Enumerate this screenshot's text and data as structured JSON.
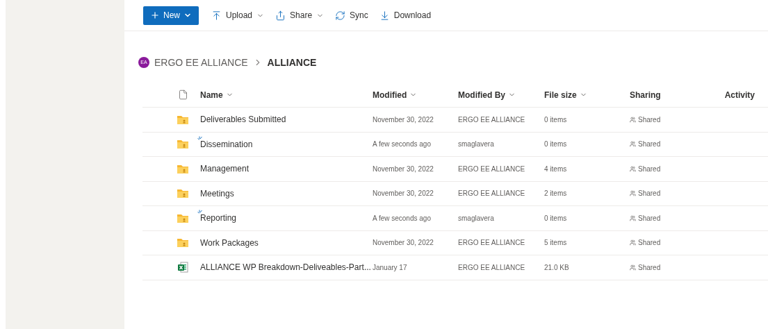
{
  "toolbar": [
    {
      "kind": "new",
      "label": "New"
    },
    {
      "kind": "upload",
      "label": "Upload",
      "menu": true
    },
    {
      "kind": "share",
      "label": "Share",
      "menu": true
    },
    {
      "kind": "sync",
      "label": "Sync",
      "menu": false
    },
    {
      "kind": "download",
      "label": "Download",
      "menu": false
    }
  ],
  "breadcrumb": {
    "avatar": "EA",
    "items": [
      "ERGO EE ALLIANCE",
      "ALLIANCE"
    ]
  },
  "table": {
    "columns": [
      {
        "label": "Name",
        "sortable": true
      },
      {
        "label": "Modified",
        "sortable": true
      },
      {
        "label": "Modified By",
        "sortable": true
      },
      {
        "label": "File size",
        "sortable": true
      },
      {
        "label": "Sharing",
        "sortable": false
      },
      {
        "label": "Activity",
        "sortable": false
      }
    ],
    "rows": [
      {
        "kind": "folder",
        "new": false,
        "name": "Deliverables Submitted",
        "modified": "November 30, 2022",
        "modified_by": "ERGO EE ALLIANCE",
        "size": "0 items",
        "sharing": "Shared"
      },
      {
        "kind": "folder",
        "new": true,
        "name": "Dissemination",
        "modified": "A few seconds ago",
        "modified_by": "smaglavera",
        "size": "0 items",
        "sharing": "Shared"
      },
      {
        "kind": "folder",
        "new": false,
        "name": "Management",
        "modified": "November 30, 2022",
        "modified_by": "ERGO EE ALLIANCE",
        "size": "4 items",
        "sharing": "Shared"
      },
      {
        "kind": "folder",
        "new": false,
        "name": "Meetings",
        "modified": "November 30, 2022",
        "modified_by": "ERGO EE ALLIANCE",
        "size": "2 items",
        "sharing": "Shared"
      },
      {
        "kind": "folder",
        "new": true,
        "name": "Reporting",
        "modified": "A few seconds ago",
        "modified_by": "smaglavera",
        "size": "0 items",
        "sharing": "Shared"
      },
      {
        "kind": "folder",
        "new": false,
        "name": "Work Packages",
        "modified": "November 30, 2022",
        "modified_by": "ERGO EE ALLIANCE",
        "size": "5 items",
        "sharing": "Shared"
      },
      {
        "kind": "excel",
        "new": false,
        "name": "ALLIANCE WP Breakdown-Deliveables-Part...",
        "modified": "January 17",
        "modified_by": "ERGO EE ALLIANCE",
        "size": "21.0 KB",
        "sharing": "Shared"
      }
    ]
  }
}
